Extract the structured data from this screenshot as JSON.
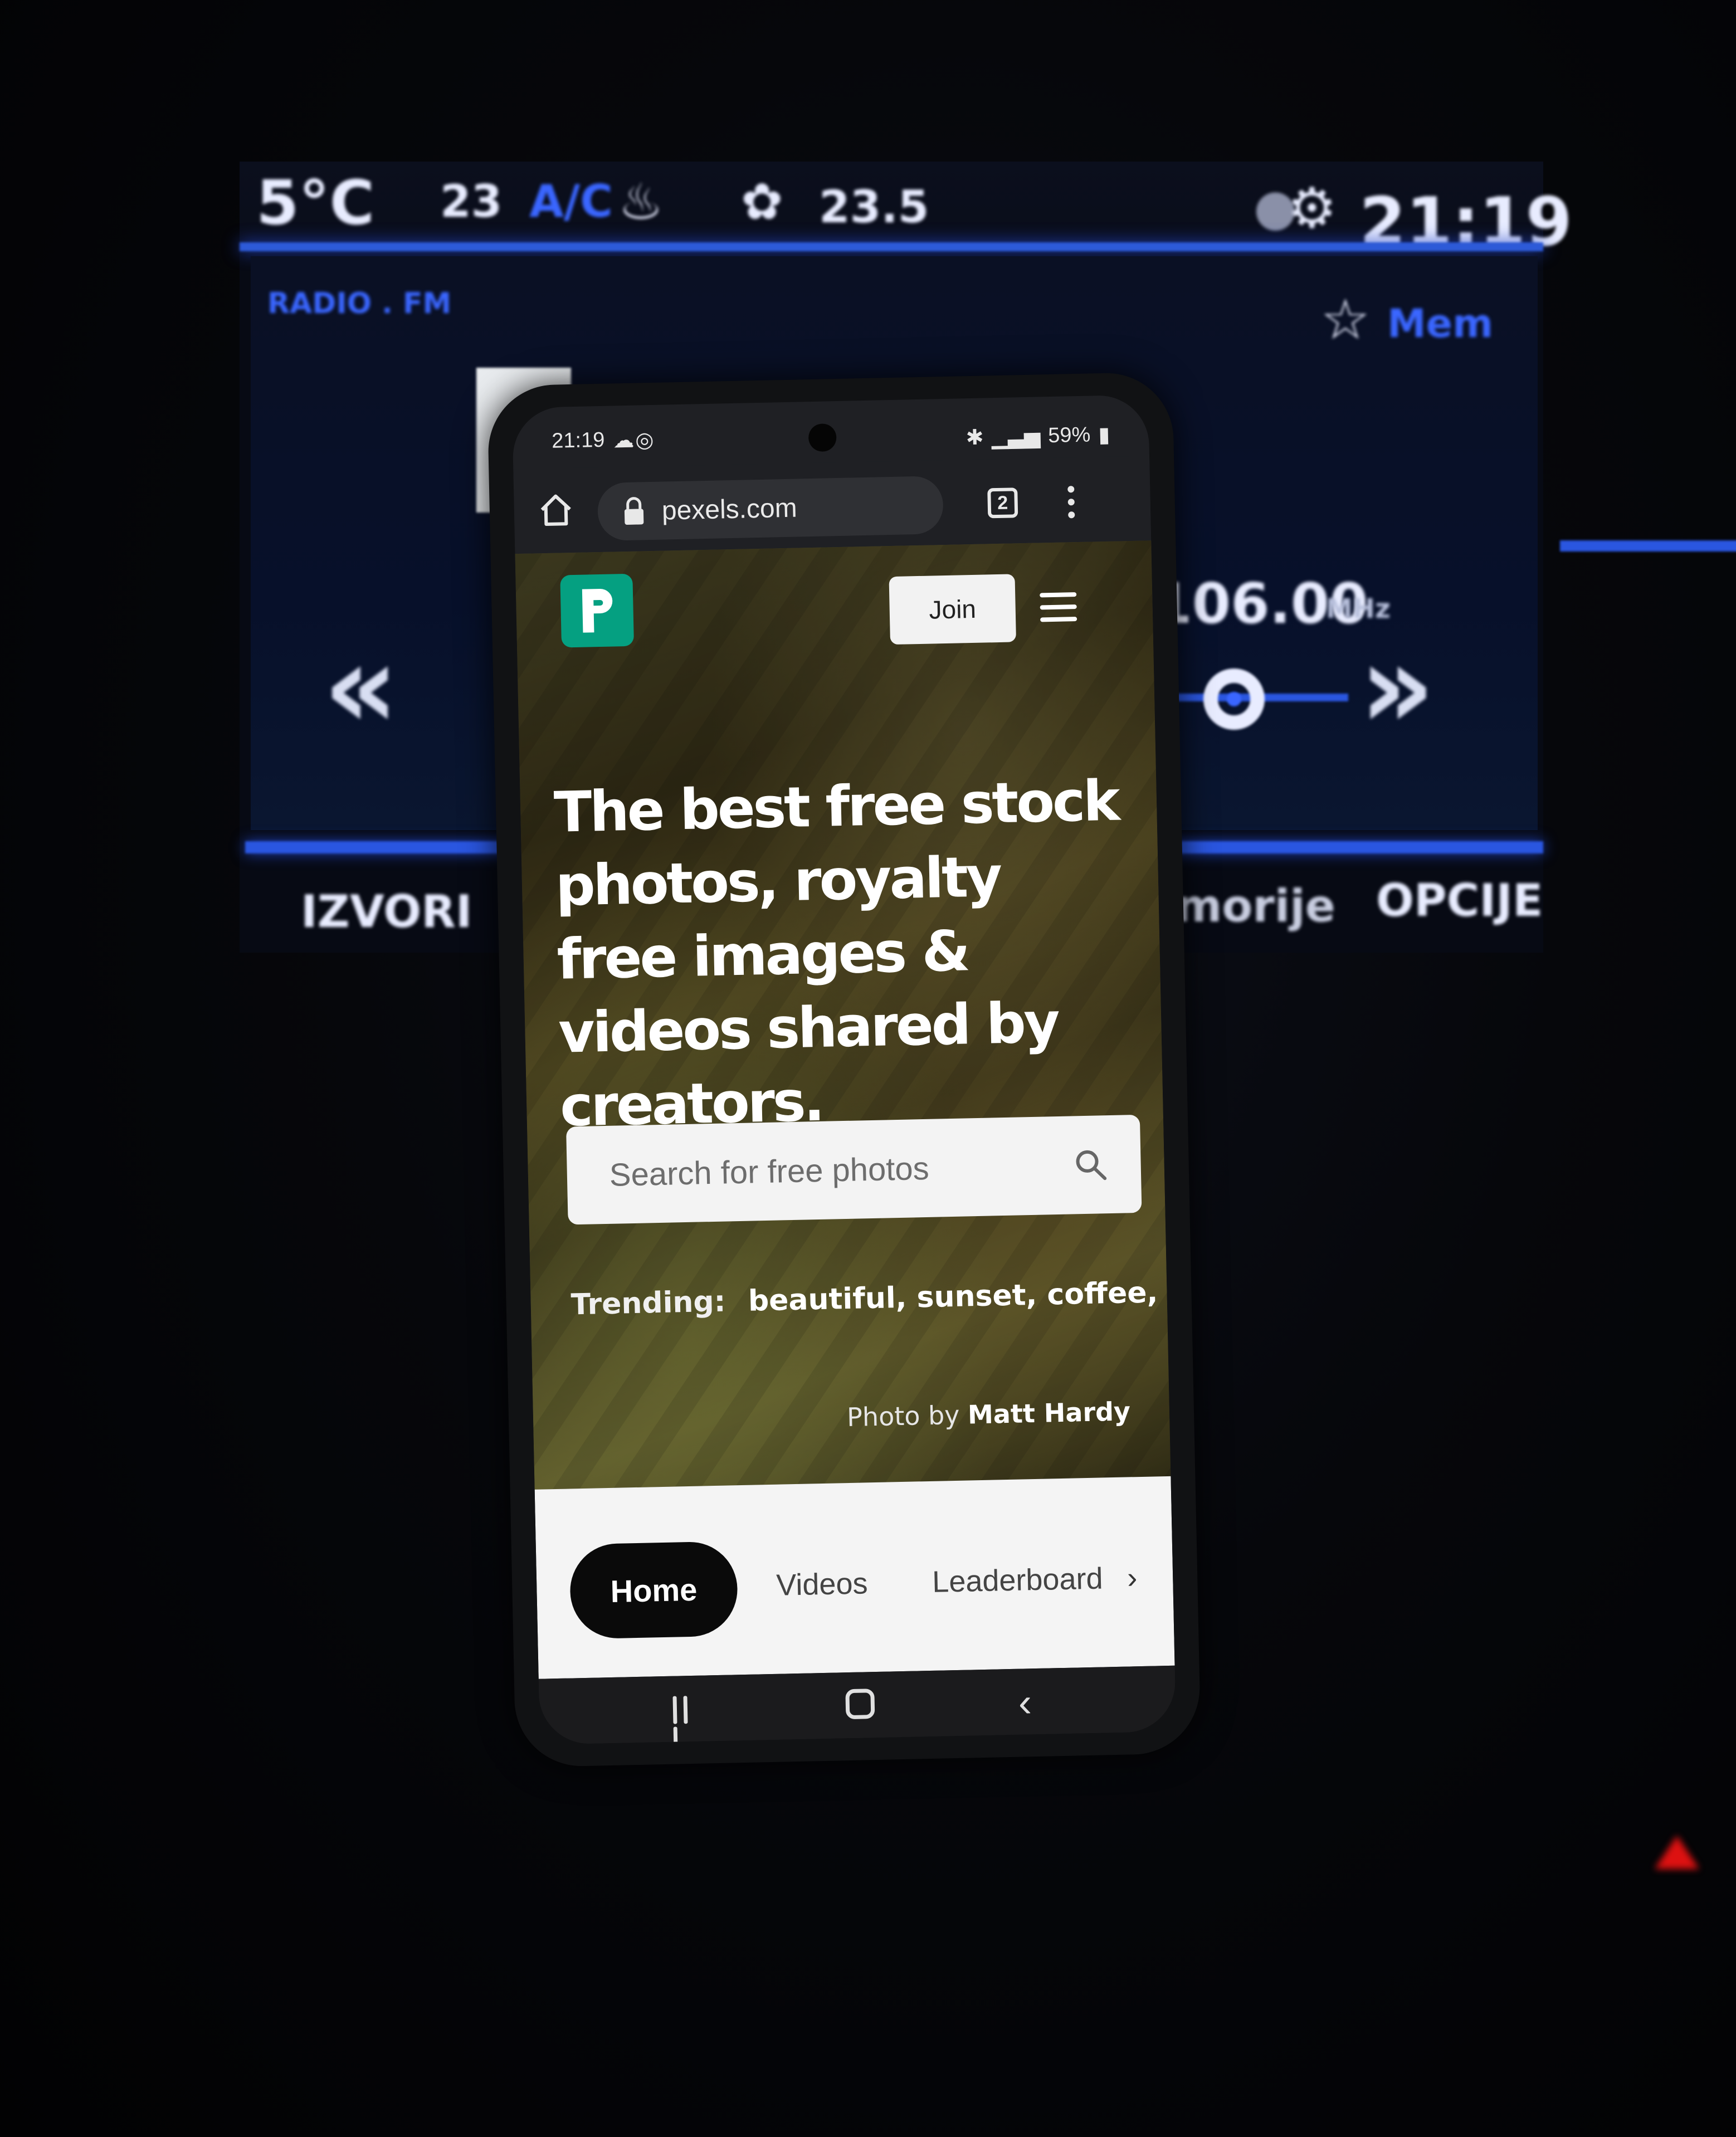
{
  "car_display": {
    "outside_temp": "5°C",
    "driver_temp": "23",
    "ac_label": "A/C",
    "passenger_temp": "23.5",
    "clock": "21:19",
    "source_label": "RADIO . FM",
    "favorites_label": "Mem",
    "frequency": "106.00",
    "frequency_unit": "MHz",
    "bottom_left_label": "IZVORI",
    "bottom_right_label": "OPCIJE",
    "bottom_mid_label": "morije",
    "prev_glyph": "«",
    "next_glyph": "»"
  },
  "phone": {
    "status": {
      "time": "21:19",
      "battery": "59%"
    },
    "browser": {
      "url": "pexels.com",
      "tab_count": "2"
    },
    "hero": {
      "join_label": "Join",
      "headline": "The best free stock photos, royalty free images & videos shared by creators.",
      "search_placeholder": "Search for free photos",
      "trending_label": "Trending:",
      "trending_tags": "beautiful, sunset, coffee, car,",
      "credit_prefix": "Photo by",
      "credit_name": "Matt Hardy"
    },
    "tabs": {
      "home": "Home",
      "videos": "Videos",
      "leaderboard": "Leaderboard",
      "chevron": "›"
    },
    "nav": {
      "back_glyph": "‹"
    }
  },
  "colors": {
    "brand_green": "#05a081",
    "car_accent_blue": "#2d5ad8"
  }
}
